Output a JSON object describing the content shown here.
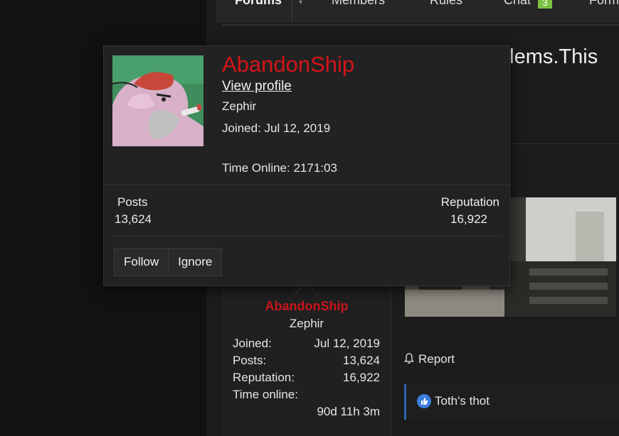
{
  "nav": {
    "items": [
      "Forums",
      "Members",
      "Rules",
      "Chat",
      "Forms"
    ],
    "chat_badge": "3"
  },
  "thread": {
    "title_fragment": "plems.This"
  },
  "popup": {
    "username": "AbandonShip",
    "view_profile": "View profile",
    "user_title": "Zephir",
    "joined": "Joined: Jul 12, 2019",
    "time_online": "Time Online: 2171:03",
    "posts_label": "Posts",
    "posts_value": "13,624",
    "reputation_label": "Reputation",
    "reputation_value": "16,922",
    "follow_label": "Follow",
    "ignore_label": "Ignore"
  },
  "post_user": {
    "username": "AbandonShip",
    "user_title": "Zephir",
    "stats": [
      {
        "label": "Joined:",
        "value": "Jul 12, 2019"
      },
      {
        "label": "Posts:",
        "value": "13,624"
      },
      {
        "label": "Reputation:",
        "value": "16,922"
      },
      {
        "label": "Time online:",
        "value": "90d 11h 3m"
      }
    ]
  },
  "post": {
    "report_label": "Report",
    "reaction_text": "Toth's thot"
  },
  "colors": {
    "username": "#d4141a",
    "chat_badge": "#7cc242",
    "reaction_accent": "#2f63b5"
  }
}
